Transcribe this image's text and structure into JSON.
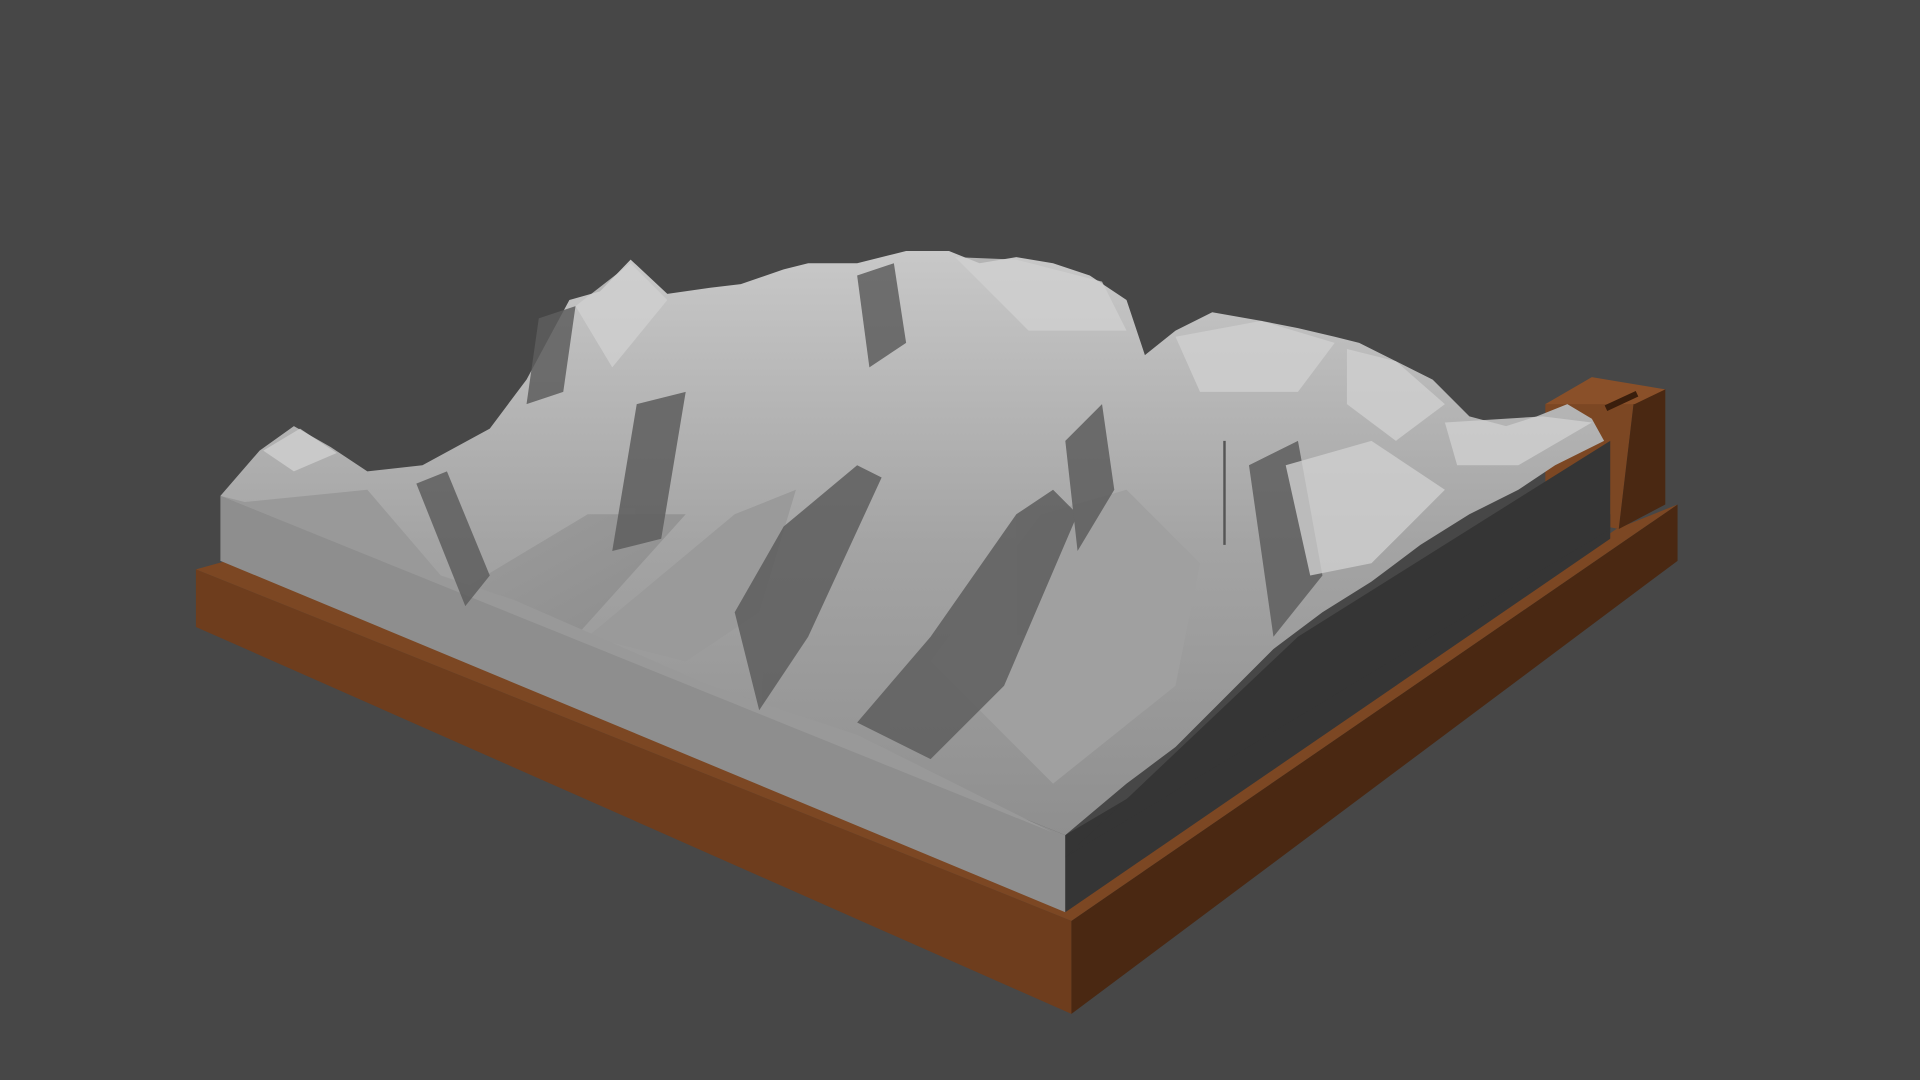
{
  "scene": {
    "background_color": "#474747",
    "terrain_color": "#9a9a9a",
    "terrain_highlight": "#c4c4c4",
    "terrain_shadow": "#5a5a5a",
    "block_side_color": "#8e8e8e",
    "block_dark_side_color": "#353535",
    "base_top_color": "#7a4522",
    "base_front_color": "#6b3b1c",
    "base_side_color": "#4a2812"
  }
}
